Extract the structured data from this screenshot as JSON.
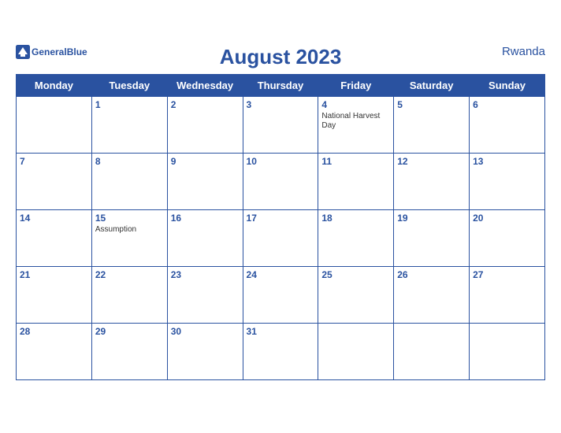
{
  "brand": {
    "general": "General",
    "blue": "Blue",
    "logo_alt": "GeneralBlue logo"
  },
  "title": "August 2023",
  "country": "Rwanda",
  "weekdays": [
    "Monday",
    "Tuesday",
    "Wednesday",
    "Thursday",
    "Friday",
    "Saturday",
    "Sunday"
  ],
  "weeks": [
    [
      {
        "day": "",
        "holiday": ""
      },
      {
        "day": "1",
        "holiday": ""
      },
      {
        "day": "2",
        "holiday": ""
      },
      {
        "day": "3",
        "holiday": ""
      },
      {
        "day": "4",
        "holiday": "National Harvest Day"
      },
      {
        "day": "5",
        "holiday": ""
      },
      {
        "day": "6",
        "holiday": ""
      }
    ],
    [
      {
        "day": "7",
        "holiday": ""
      },
      {
        "day": "8",
        "holiday": ""
      },
      {
        "day": "9",
        "holiday": ""
      },
      {
        "day": "10",
        "holiday": ""
      },
      {
        "day": "11",
        "holiday": ""
      },
      {
        "day": "12",
        "holiday": ""
      },
      {
        "day": "13",
        "holiday": ""
      }
    ],
    [
      {
        "day": "14",
        "holiday": ""
      },
      {
        "day": "15",
        "holiday": "Assumption"
      },
      {
        "day": "16",
        "holiday": ""
      },
      {
        "day": "17",
        "holiday": ""
      },
      {
        "day": "18",
        "holiday": ""
      },
      {
        "day": "19",
        "holiday": ""
      },
      {
        "day": "20",
        "holiday": ""
      }
    ],
    [
      {
        "day": "21",
        "holiday": ""
      },
      {
        "day": "22",
        "holiday": ""
      },
      {
        "day": "23",
        "holiday": ""
      },
      {
        "day": "24",
        "holiday": ""
      },
      {
        "day": "25",
        "holiday": ""
      },
      {
        "day": "26",
        "holiday": ""
      },
      {
        "day": "27",
        "holiday": ""
      }
    ],
    [
      {
        "day": "28",
        "holiday": ""
      },
      {
        "day": "29",
        "holiday": ""
      },
      {
        "day": "30",
        "holiday": ""
      },
      {
        "day": "31",
        "holiday": ""
      },
      {
        "day": "",
        "holiday": ""
      },
      {
        "day": "",
        "holiday": ""
      },
      {
        "day": "",
        "holiday": ""
      }
    ]
  ]
}
